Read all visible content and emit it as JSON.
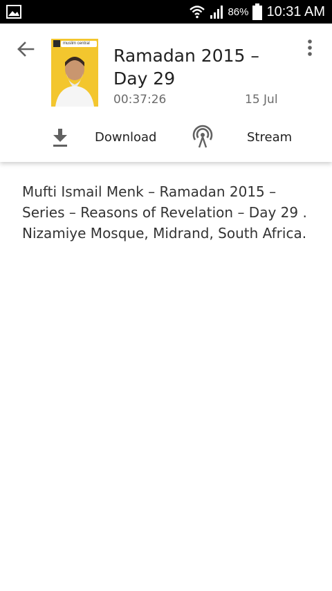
{
  "status_bar": {
    "battery_percent": "86%",
    "time": "10:31 AM",
    "icons": [
      "gallery-icon",
      "wifi-icon",
      "signal-icon",
      "battery-icon"
    ]
  },
  "episode": {
    "title": "Ramadan 2015 – Day 29",
    "duration": "00:37:26",
    "date": "15 Jul",
    "thumbnail_text": "muslim central"
  },
  "actions": {
    "download_label": "Download",
    "stream_label": "Stream"
  },
  "description": "Mufti Ismail Menk – Ramadan 2015 – Series – Reasons of Revelation – Day 29 . Nizamiye Mosque, Midrand, South Africa.",
  "colors": {
    "status_bar": "#000000",
    "thumbnail_bg": "#f3c62e",
    "icon_gray": "#616161",
    "secondary_text": "#6b6b6b"
  }
}
